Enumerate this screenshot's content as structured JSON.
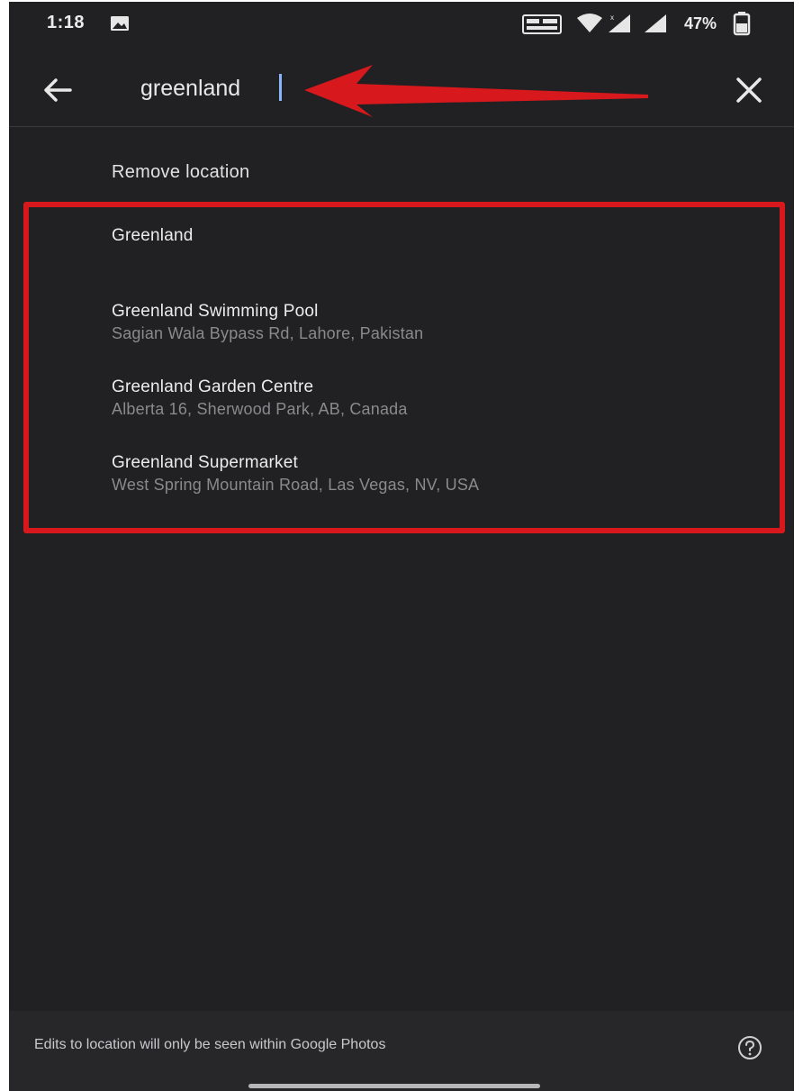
{
  "status_bar": {
    "time": "1:18",
    "battery_percent": "47%",
    "icons": [
      "gallery-icon",
      "volte-icon",
      "wifi-icon",
      "signal-icon",
      "signal-icon",
      "battery-icon"
    ]
  },
  "search": {
    "value": "greenland"
  },
  "remove_location_label": "Remove location",
  "results": [
    {
      "title": "Greenland",
      "subtitle": ""
    },
    {
      "title": "Greenland Swimming Pool",
      "subtitle": "Sagian Wala Bypass Rd, Lahore, Pakistan"
    },
    {
      "title": "Greenland Garden Centre",
      "subtitle": "Alberta 16, Sherwood Park, AB, Canada"
    },
    {
      "title": "Greenland Supermarket",
      "subtitle": "West Spring Mountain Road, Las Vegas, NV, USA"
    }
  ],
  "footer": {
    "note": "Edits to location will only be seen within Google Photos"
  },
  "colors": {
    "background": "#212123",
    "annotation_red": "#d7181c",
    "caret_blue": "#8ab4f8"
  }
}
